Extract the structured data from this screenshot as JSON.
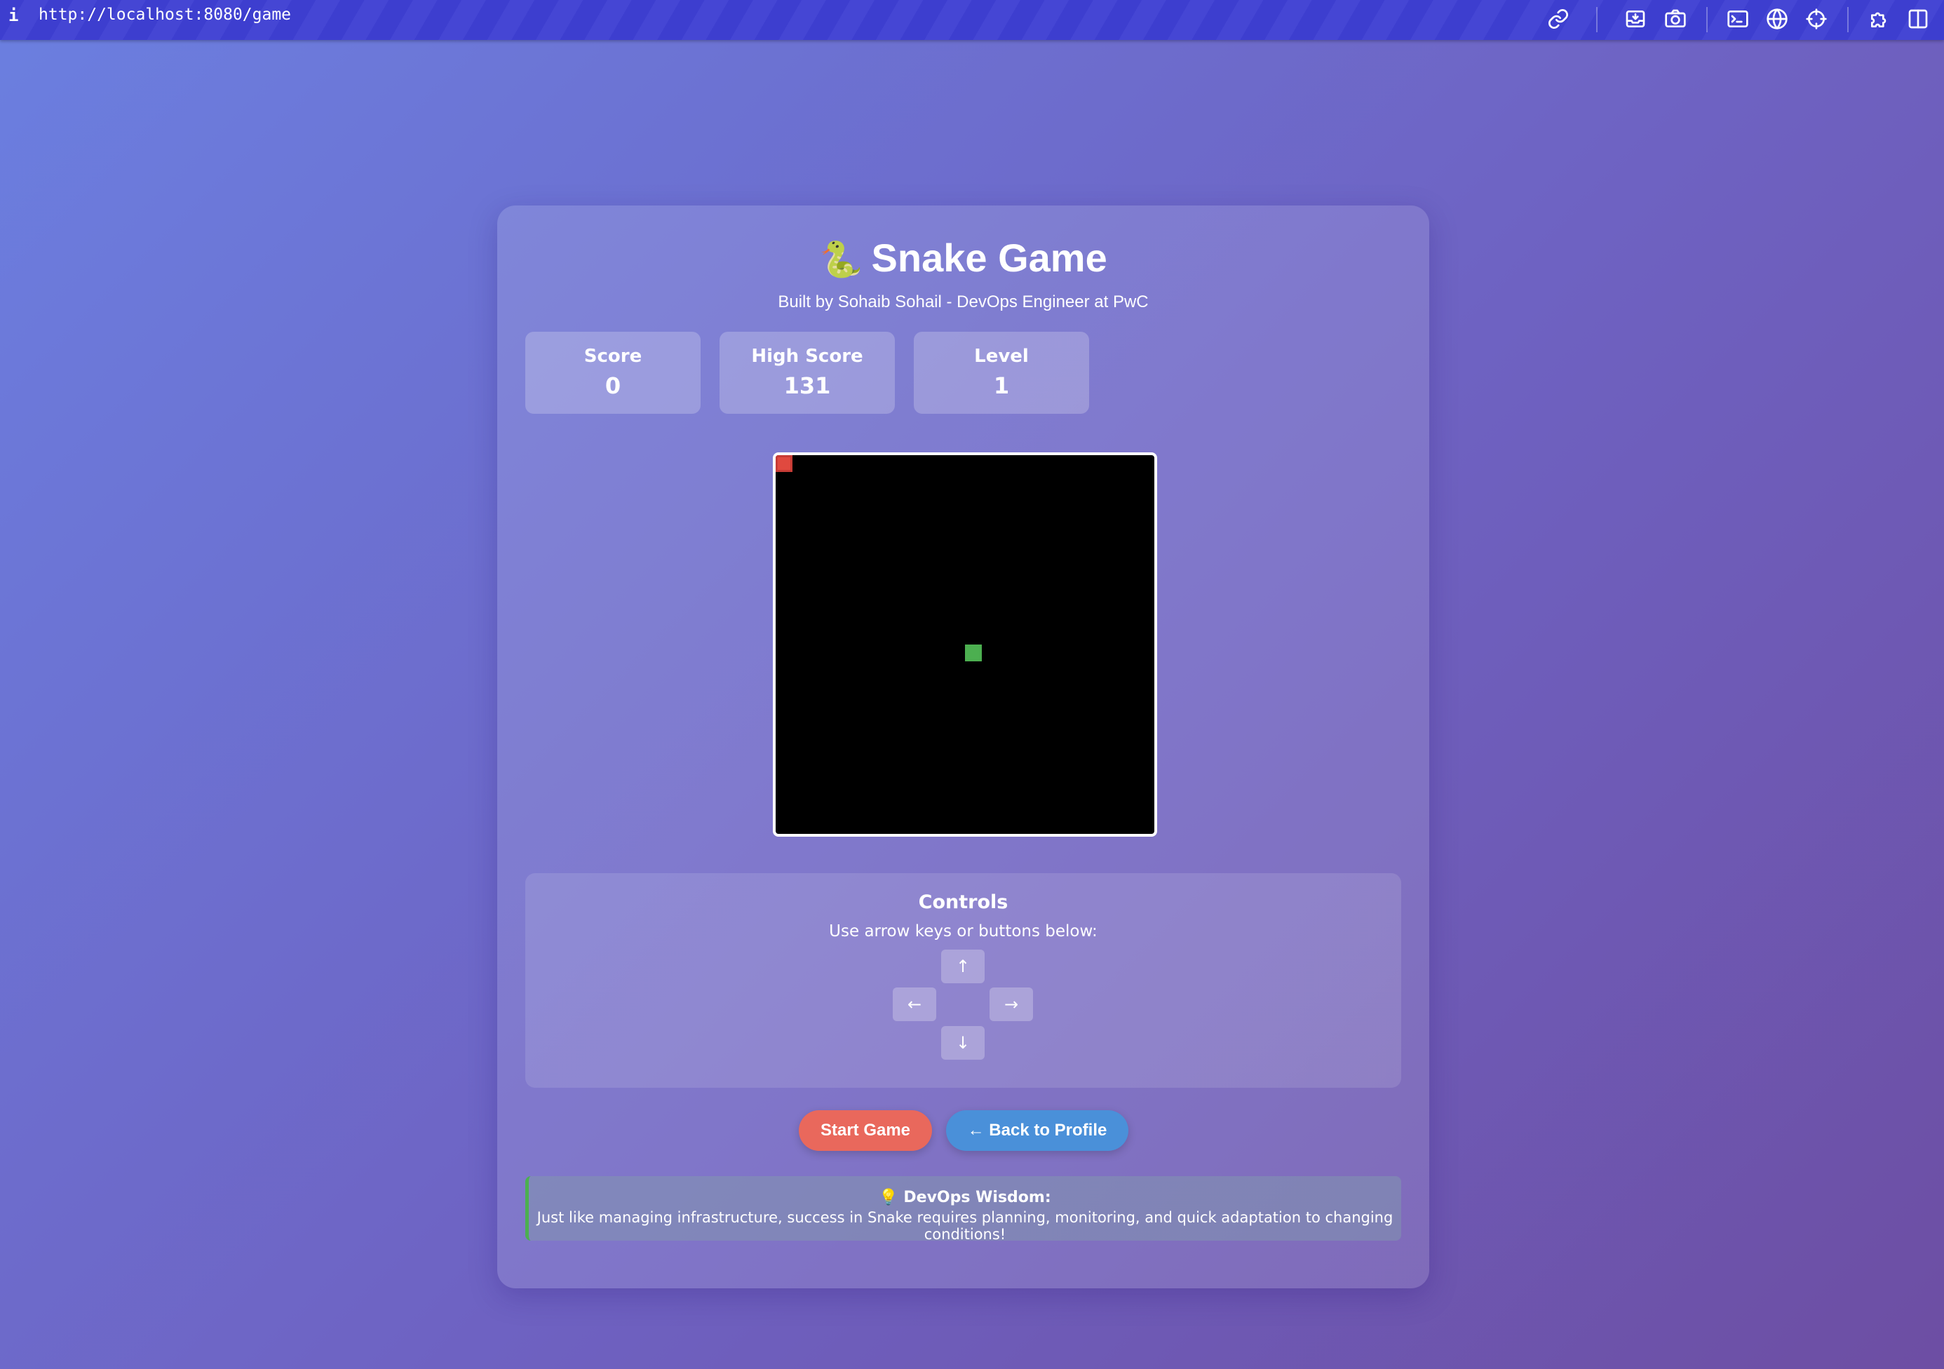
{
  "browser": {
    "info_icon": "i",
    "url": "http://localhost:8080/game",
    "toolbar_icons": [
      "link-icon",
      "inbox-icon",
      "camera-icon",
      "terminal-icon",
      "globe-icon",
      "crosshair-icon",
      "puzzle-icon",
      "sidebar-icon"
    ]
  },
  "game": {
    "title_icon": "🐍",
    "title": "Snake Game",
    "subtitle": "Built by Sohaib Sohail - DevOps Engineer at PwC",
    "stats": {
      "score_label": "Score",
      "score_value": "0",
      "high_label": "High Score",
      "high_value": "131",
      "level_label": "Level",
      "level_value": "1"
    },
    "board": {
      "background": "#000000",
      "food_color": "#e0493f",
      "snake_color": "#4caf50"
    },
    "controls": {
      "title": "Controls",
      "description": "Use arrow keys or buttons below:",
      "up": "↑",
      "left": "←",
      "right": "→",
      "down": "↓"
    },
    "buttons": {
      "start": "Start Game",
      "back": "← Back to Profile"
    },
    "wisdom": {
      "title": "💡 DevOps Wisdom:",
      "text": "Just like managing infrastructure, success in Snake requires planning, monitoring, and quick adaptation to changing conditions!"
    }
  },
  "colors": {
    "accent_start": "#e9685c",
    "accent_back": "#4a90d9",
    "wisdom_border": "#4caf50"
  }
}
